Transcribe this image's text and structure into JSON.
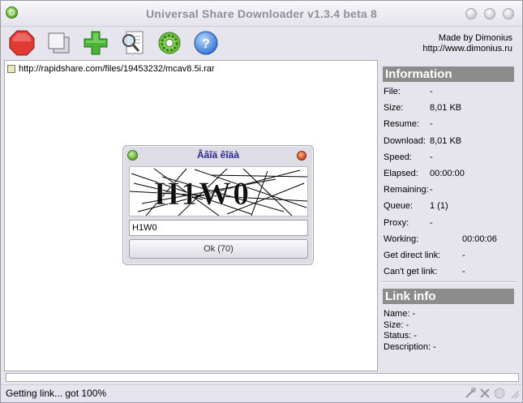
{
  "window": {
    "title": "Universal Share Downloader v1.3.4 beta 8"
  },
  "toolbar": {
    "buttons": [
      {
        "icon": "stop-icon"
      },
      {
        "icon": "copy-icon"
      },
      {
        "icon": "add-icon"
      },
      {
        "icon": "search-document-icon"
      },
      {
        "icon": "settings-icon"
      },
      {
        "icon": "help-icon"
      }
    ],
    "made_by": "Made by Dimonius",
    "site": "http://www.dimonius.ru"
  },
  "links": [
    {
      "url": "http://rapidshare.com/files/19453232/mcav8.5i.rar"
    }
  ],
  "information": {
    "heading": "Information",
    "rows": [
      {
        "label": "File:",
        "value": "-"
      },
      {
        "label": "Size:",
        "value": "8,01 KB"
      },
      {
        "label": "Resume:",
        "value": "-"
      },
      {
        "label": "Download:",
        "value": "8,01 KB"
      },
      {
        "label": "Speed:",
        "value": "-"
      },
      {
        "label": "Elapsed:",
        "value": "00:00:00"
      },
      {
        "label": "Remaining:",
        "value": "-"
      },
      {
        "label": "Queue:",
        "value": "1 (1)"
      },
      {
        "label": "Proxy:",
        "value": "-"
      },
      {
        "label": "Working:",
        "value": "00:00:06"
      },
      {
        "label": "Get direct link:",
        "value": "-"
      },
      {
        "label": "Can't get link:",
        "value": "-"
      }
    ]
  },
  "link_info": {
    "heading": "Link info",
    "rows": [
      {
        "text": "Name: -"
      },
      {
        "text": "Size: -"
      },
      {
        "text": "Status: -"
      },
      {
        "text": "Description: -"
      }
    ]
  },
  "captcha_dialog": {
    "title": "Ââîä êîäà",
    "input_value": "H1W0",
    "ok_label": "Ok (70)"
  },
  "progress": {
    "value": 1.0
  },
  "status": {
    "text": "Getting link... got 100%"
  },
  "colors": {
    "section_header": "#8c8c8c",
    "dialog_title": "#2a2a8c",
    "stop_red": "#d9302a",
    "add_green": "#3aa62a"
  }
}
